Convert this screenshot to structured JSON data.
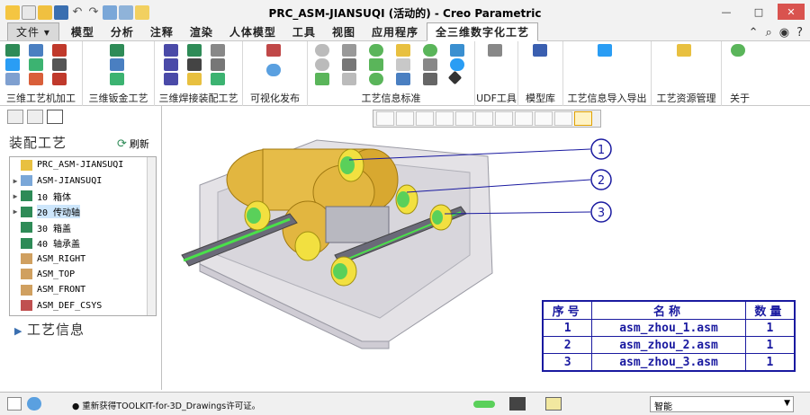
{
  "window": {
    "title": "PRC_ASM-JIANSUQI (活动的) - Creo Parametric"
  },
  "tabs": [
    "文件 ▾",
    "模型",
    "分析",
    "注释",
    "渲染",
    "人体模型",
    "工具",
    "视图",
    "应用程序",
    "全三维数字化工艺"
  ],
  "ribbon_groups": [
    "三维工艺机加工",
    "三维钣金工艺",
    "三维焊接装配工艺",
    "可视化发布",
    "工艺信息标准",
    "UDF工具",
    "模型库",
    "工艺信息导入导出",
    "工艺资源管理",
    "关于"
  ],
  "left_panel": {
    "heading": "装配工艺",
    "refresh_label": "刷新",
    "info_heading": "工艺信息",
    "tree": [
      {
        "label": "PRC_ASM-JIANSUQI",
        "expander": ""
      },
      {
        "label": "ASM-JIANSUQI",
        "expander": "▶"
      },
      {
        "label": "10 箱体",
        "expander": "▶"
      },
      {
        "label": "20 传动轴",
        "expander": "▶"
      },
      {
        "label": "30 箱盖",
        "expander": ""
      },
      {
        "label": "40 轴承盖",
        "expander": ""
      },
      {
        "label": "ASM_RIGHT",
        "expander": ""
      },
      {
        "label": "ASM_TOP",
        "expander": ""
      },
      {
        "label": "ASM_FRONT",
        "expander": ""
      },
      {
        "label": "ASM_DEF_CSYS",
        "expander": ""
      }
    ]
  },
  "callouts": [
    "1",
    "2",
    "3"
  ],
  "bom": {
    "headers": [
      "序号",
      "名称",
      "数量"
    ],
    "rows": [
      {
        "no": "1",
        "name": "asm_zhou_1.asm",
        "qty": "1"
      },
      {
        "no": "2",
        "name": "asm_zhou_2.asm",
        "qty": "1"
      },
      {
        "no": "3",
        "name": "asm_zhou_3.asm",
        "qty": "1"
      }
    ]
  },
  "status": {
    "message": "● 重新获得TOOLKIT-for-3D_Drawings许可证。",
    "filter": "智能"
  }
}
